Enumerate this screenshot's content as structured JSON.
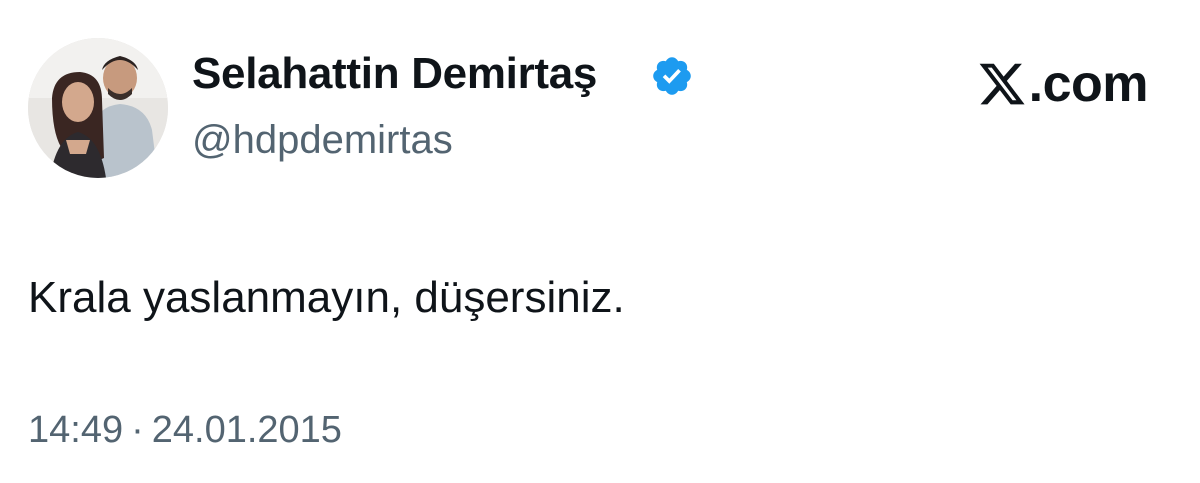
{
  "author": {
    "display_name": "Selahattin Demirtaş",
    "handle": "@hdpdemirtas",
    "verified_badge_icon": "verified-badge-icon",
    "verified_color": "#1d9bf0"
  },
  "brand": {
    "logo_icon": "x-logo-icon",
    "text": ".com"
  },
  "tweet": {
    "text": "Krala yaslanmayın, düşersiniz.",
    "time": "14:49",
    "separator": "·",
    "date": "24.01.2015"
  },
  "colors": {
    "text_primary": "#0f1419",
    "text_secondary": "#536471"
  }
}
